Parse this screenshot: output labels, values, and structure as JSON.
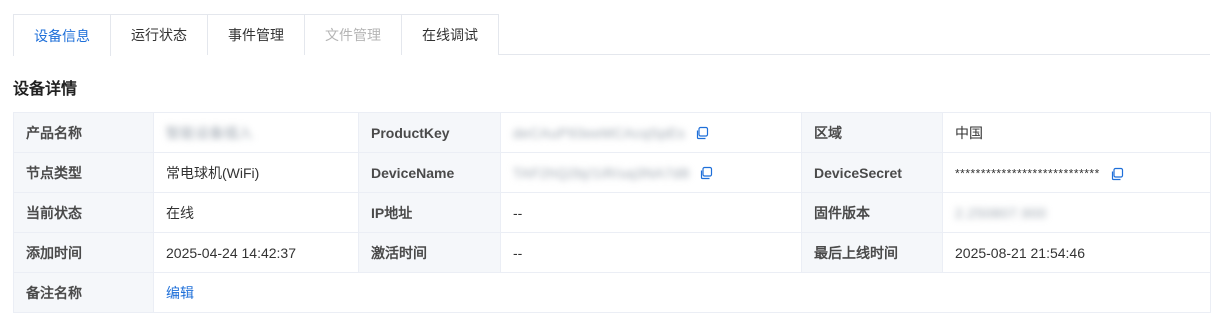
{
  "tabs": [
    {
      "label": "设备信息",
      "state": "active"
    },
    {
      "label": "运行状态",
      "state": "normal"
    },
    {
      "label": "事件管理",
      "state": "normal"
    },
    {
      "label": "文件管理",
      "state": "disabled"
    },
    {
      "label": "在线调试",
      "state": "normal"
    }
  ],
  "section_title": "设备详情",
  "details": {
    "product_name_label": "产品名称",
    "product_name_value": "智能设备插入",
    "product_key_label": "ProductKey",
    "product_key_value": "deCAuP93eeMCAcqSpEs",
    "region_label": "区域",
    "region_value": "中国",
    "node_type_label": "节点类型",
    "node_type_value": "常电球机(WiFi)",
    "device_name_label": "DeviceName",
    "device_name_value": "TAF2hQ2bj/1iR/uq3NA7d8",
    "device_secret_label": "DeviceSecret",
    "device_secret_value": "****************************",
    "status_label": "当前状态",
    "status_value": "在线",
    "ip_label": "IP地址",
    "ip_value": "--",
    "firmware_label": "固件版本",
    "firmware_value": "2.250807.900",
    "added_time_label": "添加时间",
    "added_time_value": "2025-04-24 14:42:37",
    "activated_time_label": "激活时间",
    "activated_time_value": "--",
    "last_online_label": "最后上线时间",
    "last_online_value": "2025-08-21 21:54:46",
    "remark_label": "备注名称",
    "remark_edit": "编辑"
  },
  "colors": {
    "accent": "#1e6fd9",
    "label_bg": "#f5f7fa",
    "border": "#ebeef5",
    "disabled_text": "#b5b5b5"
  },
  "icons": {
    "copy": "copy-icon"
  }
}
